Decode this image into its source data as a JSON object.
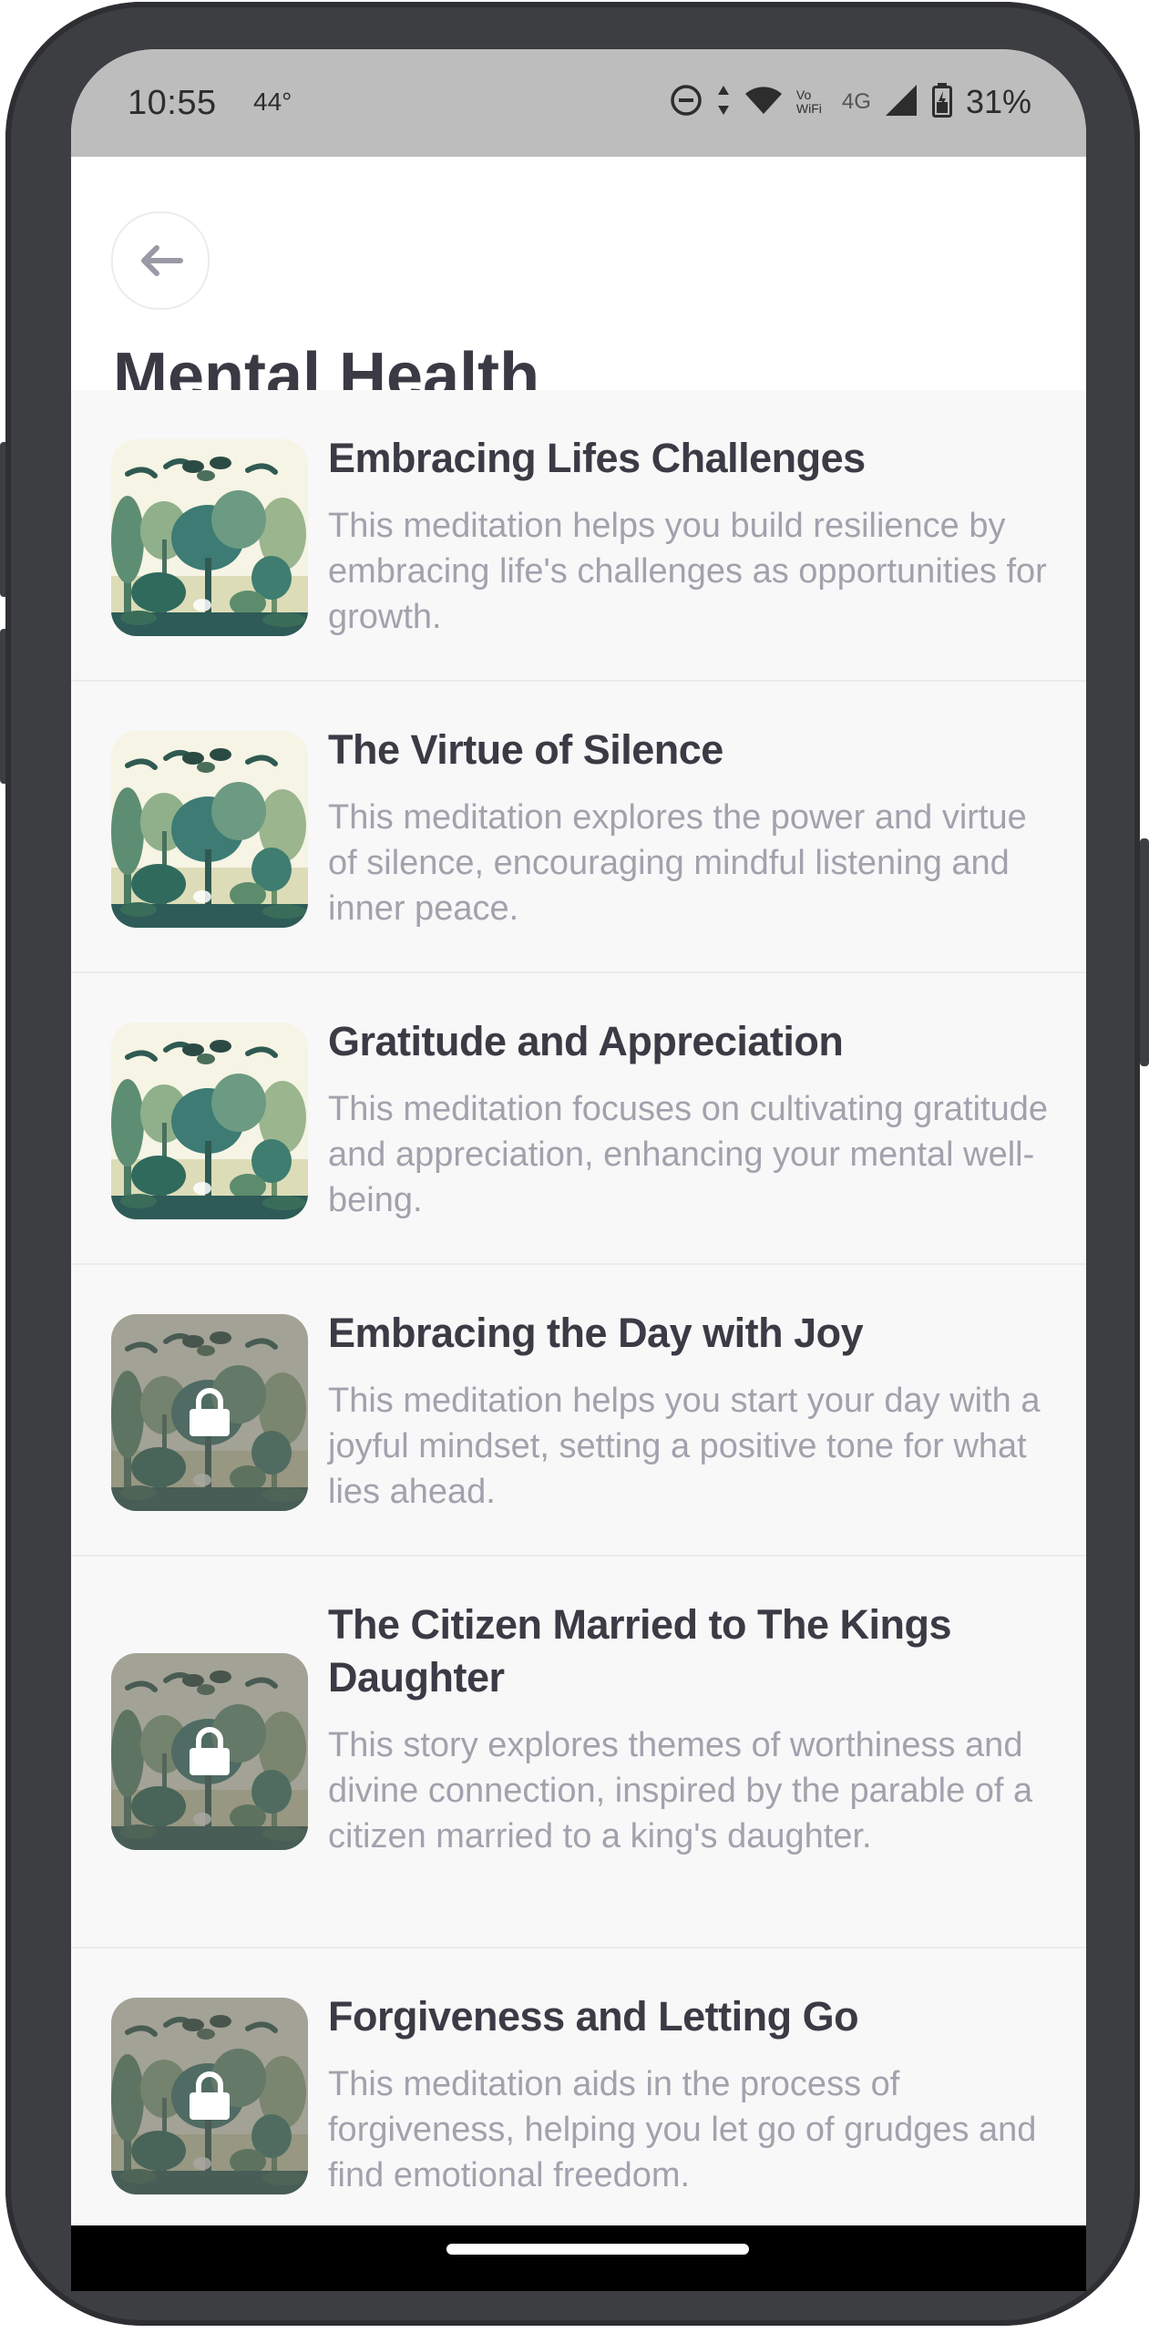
{
  "status_bar": {
    "time": "10:55",
    "temperature": "44°",
    "network_label": "4G",
    "wifi_label": "Vo WiFi",
    "battery": "31%",
    "icons": [
      "do-not-disturb-icon",
      "data-arrows-icon",
      "wifi-icon",
      "signal-icon",
      "battery-icon"
    ]
  },
  "header": {
    "back_icon": "arrow-left-icon",
    "title": "Mental Health"
  },
  "items": [
    {
      "title": "Embracing Lifes Challenges",
      "description": "This meditation helps you build resilience by embracing life's challenges as opportunities for growth.",
      "locked": false
    },
    {
      "title": "The Virtue of Silence",
      "description": "This meditation explores the power and virtue of silence, encouraging mindful listening and inner peace.",
      "locked": false
    },
    {
      "title": "Gratitude and Appreciation",
      "description": "This meditation focuses on cultivating gratitude and appreciation, enhancing your mental well-being.",
      "locked": false
    },
    {
      "title": "Embracing the Day with Joy",
      "description": "This meditation helps you start your day with a joyful mindset, setting a positive tone for what lies ahead.",
      "locked": true
    },
    {
      "title": "The Citizen Married to The Kings Daughter",
      "description": "This story explores themes of worthiness and divine connection, inspired by the parable of a citizen married to a king's daughter.",
      "locked": true
    },
    {
      "title": "Forgiveness and Letting Go",
      "description": "This meditation aids in the process of forgiveness, helping you let go of grudges and find emotional freedom.",
      "locked": true
    }
  ],
  "colors": {
    "title_text": "#3a3a45",
    "description_text": "#a2a2ad",
    "status_bar_bg": "#bdbdbd",
    "frame": "#3d3e42"
  }
}
